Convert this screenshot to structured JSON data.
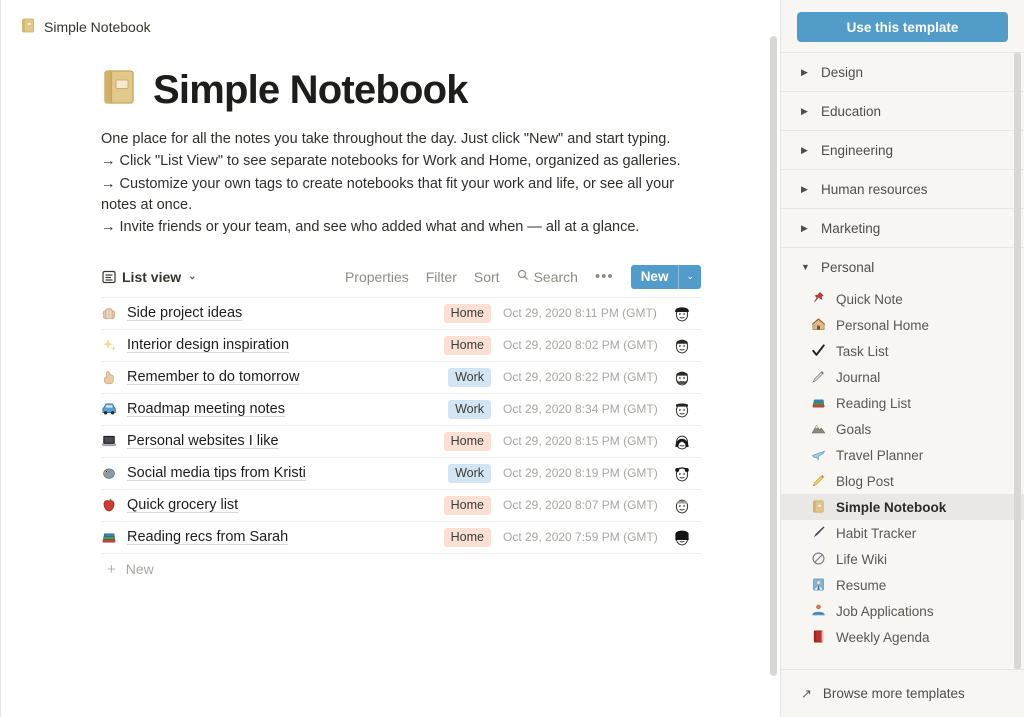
{
  "breadcrumb": {
    "icon": "notebook-icon",
    "label": "Simple Notebook"
  },
  "page": {
    "emoji": "notebook-icon",
    "title": "Simple Notebook",
    "intro_lines": [
      "One place for all the notes you take throughout the day. Just click \"New\" and start typing.",
      "→ Click \"List View\" to see separate notebooks for Work and Home, organized as galleries.",
      "→ Customize your own tags to create notebooks that fit your work and life, or see all your notes at once.",
      "→ Invite friends or your team, and see who added what and when — all at a glance."
    ]
  },
  "toolbar": {
    "view_label": "List view",
    "view_caret": "⌄",
    "properties_label": "Properties",
    "filter_label": "Filter",
    "sort_label": "Sort",
    "search_label": "Search",
    "more_label": "•••",
    "new_label": "New",
    "new_caret": "⌄",
    "accent_color": "#529cca"
  },
  "table": {
    "rows": [
      {
        "icon": "brain-icon",
        "emoji": "🧠",
        "name": "Side project ideas",
        "tag": "Home",
        "tag_class": "home",
        "date": "Oct 29, 2020 8:11 PM (GMT)",
        "avatar": "avatar-dark-hair"
      },
      {
        "icon": "sparkles-icon",
        "emoji": "✨",
        "name": "Interior design inspiration",
        "tag": "Home",
        "tag_class": "home",
        "date": "Oct 29, 2020 8:02 PM (GMT)",
        "avatar": "avatar-short-hair"
      },
      {
        "icon": "finger-icon",
        "emoji": "☝️",
        "name": "Remember to do tomorrow",
        "tag": "Work",
        "tag_class": "work",
        "date": "Oct 29, 2020 8:22 PM (GMT)",
        "avatar": "avatar-beard"
      },
      {
        "icon": "car-icon",
        "emoji": "🚙",
        "name": "Roadmap meeting notes",
        "tag": "Work",
        "tag_class": "work",
        "date": "Oct 29, 2020 8:34 PM (GMT)",
        "avatar": "avatar-flat-top"
      },
      {
        "icon": "laptop-icon",
        "emoji": "💻",
        "name": "Personal websites I like",
        "tag": "Home",
        "tag_class": "home",
        "date": "Oct 29, 2020 8:15 PM (GMT)",
        "avatar": "avatar-long-hair"
      },
      {
        "icon": "bird-icon",
        "emoji": "🐦",
        "name": "Social media tips from Kristi",
        "tag": "Work",
        "tag_class": "work",
        "date": "Oct 29, 2020 8:19 PM (GMT)",
        "avatar": "avatar-curly"
      },
      {
        "icon": "apple-icon",
        "emoji": "🍎",
        "name": "Quick grocery list",
        "tag": "Home",
        "tag_class": "home",
        "date": "Oct 29, 2020 8:07 PM (GMT)",
        "avatar": "avatar-light"
      },
      {
        "icon": "books-icon",
        "emoji": "📚",
        "name": "Reading recs from Sarah",
        "tag": "Home",
        "tag_class": "home",
        "date": "Oct 29, 2020 7:59 PM (GMT)",
        "avatar": "avatar-bob"
      }
    ],
    "new_row_label": "New",
    "new_row_plus": "+"
  },
  "sidebar": {
    "use_template_label": "Use this template",
    "categories": [
      {
        "label": "Design",
        "expanded": false,
        "tri": "▶"
      },
      {
        "label": "Education",
        "expanded": false,
        "tri": "▶"
      },
      {
        "label": "Engineering",
        "expanded": false,
        "tri": "▶"
      },
      {
        "label": "Human resources",
        "expanded": false,
        "tri": "▶"
      },
      {
        "label": "Marketing",
        "expanded": false,
        "tri": "▶"
      },
      {
        "label": "Personal",
        "expanded": true,
        "tri": "▼"
      }
    ],
    "personal_items": [
      {
        "label": "Quick Note",
        "icon": "pushpin-icon",
        "emoji": "📌",
        "selected": false
      },
      {
        "label": "Personal Home",
        "icon": "house-icon",
        "emoji": "🏡",
        "selected": false
      },
      {
        "label": "Task List",
        "icon": "check-icon",
        "emoji": "✔️",
        "selected": false
      },
      {
        "label": "Journal",
        "icon": "pen-icon",
        "emoji": "🖊️",
        "selected": false
      },
      {
        "label": "Reading List",
        "icon": "books-icon",
        "emoji": "📚",
        "selected": false
      },
      {
        "label": "Goals",
        "icon": "mountain-icon",
        "emoji": "⛰️",
        "selected": false
      },
      {
        "label": "Travel Planner",
        "icon": "airplane-icon",
        "emoji": "✈️",
        "selected": false
      },
      {
        "label": "Blog Post",
        "icon": "pencil-icon",
        "emoji": "✏️",
        "selected": false
      },
      {
        "label": "Simple Notebook",
        "icon": "notebook-icon",
        "emoji": "📔",
        "selected": true
      },
      {
        "label": "Habit Tracker",
        "icon": "pen-nib-icon",
        "emoji": "🖋️",
        "selected": false
      },
      {
        "label": "Life Wiki",
        "icon": "circle-slash-icon",
        "emoji": "🚫",
        "selected": false
      },
      {
        "label": "Resume",
        "icon": "person-icon",
        "emoji": "👔",
        "selected": false
      },
      {
        "label": "Job Applications",
        "icon": "people-icon",
        "emoji": "👥",
        "selected": false
      },
      {
        "label": "Weekly Agenda",
        "icon": "red-book-icon",
        "emoji": "📕",
        "selected": false
      }
    ],
    "browse_more_label": "Browse more templates",
    "browse_more_icon": "↗",
    "accent_color": "#529cca",
    "background_color": "#f7f6f3",
    "selected_row_color": "#e9e8e4"
  }
}
